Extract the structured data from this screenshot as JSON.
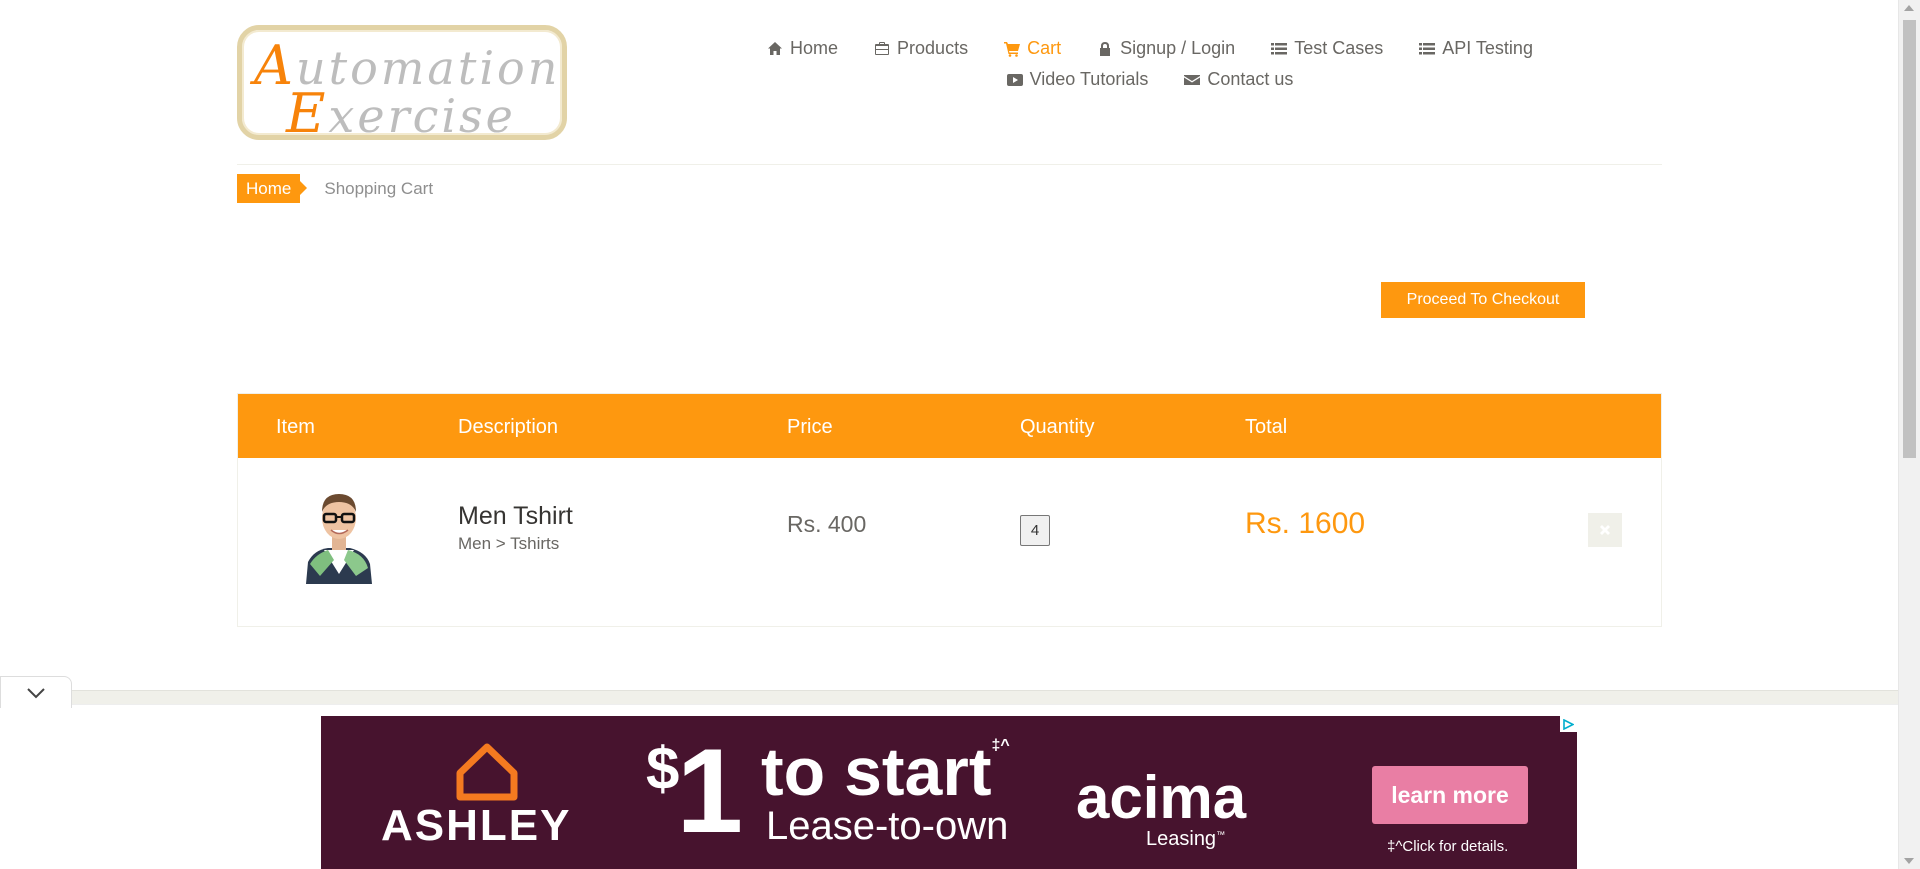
{
  "logo": {
    "line1_cap": "A",
    "line1_rest": "utomation",
    "line2_cap": "E",
    "line2_rest": "xercise"
  },
  "nav": {
    "row1": [
      {
        "label": "Home",
        "icon": "home-icon"
      },
      {
        "label": "Products",
        "icon": "briefcase-icon"
      },
      {
        "label": "Cart",
        "icon": "cart-icon",
        "active": true
      },
      {
        "label": "Signup / Login",
        "icon": "lock-icon"
      },
      {
        "label": "Test Cases",
        "icon": "list-icon"
      },
      {
        "label": "API Testing",
        "icon": "list-icon"
      }
    ],
    "row2": [
      {
        "label": "Video Tutorials",
        "icon": "youtube-icon"
      },
      {
        "label": "Contact us",
        "icon": "envelope-icon"
      }
    ]
  },
  "breadcrumb": {
    "home": "Home",
    "current": "Shopping Cart"
  },
  "checkout": {
    "label": "Proceed To Checkout"
  },
  "cart": {
    "headers": {
      "item": "Item",
      "description": "Description",
      "price": "Price",
      "quantity": "Quantity",
      "total": "Total"
    },
    "rows": [
      {
        "name": "Men Tshirt",
        "category": "Men > Tshirts",
        "price": "Rs. 400",
        "quantity": "4",
        "total": "Rs. 1600"
      }
    ]
  },
  "ad": {
    "brand": "ASHLEY",
    "amount_symbol": "$",
    "amount": "1",
    "headline": "to start",
    "headline_mark": "‡^",
    "subline": "Lease-to-own",
    "partner": "acima",
    "partner_sub": "Leasing",
    "partner_sub_mark": "™",
    "cta": "learn more",
    "footnote": "‡^Click for details."
  },
  "colors": {
    "accent": "#fe980f",
    "text": "#696763",
    "ad_bg": "#47132e",
    "cta": "#e97ea4"
  }
}
